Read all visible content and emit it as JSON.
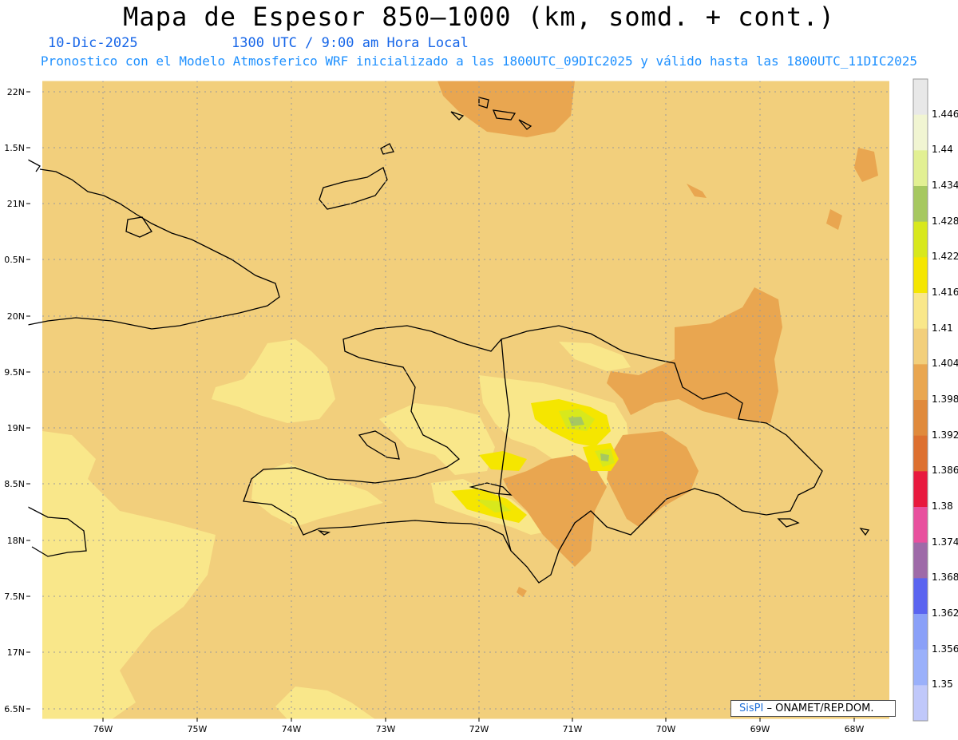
{
  "header": {
    "title": "Mapa de Espesor 850—1000 (km, somd. + cont.)",
    "date": "10-Dic-2025",
    "time": "1300 UTC / 9:00 am Hora Local",
    "description": "Pronostico con el Modelo Atmosferico WRF inicializado a las 1800UTC_09DIC2025 y válido hasta las  1800UTC_11DIC2025"
  },
  "axes": {
    "lat_labels": [
      "22N",
      "1.5N",
      "21N",
      "0.5N",
      "20N",
      "9.5N",
      "19N",
      "8.5N",
      "18N",
      "7.5N",
      "17N",
      "6.5N"
    ],
    "lon_labels": [
      "76W",
      "75W",
      "74W",
      "73W",
      "72W",
      "71W",
      "70W",
      "69W",
      "68W"
    ]
  },
  "colorbar": {
    "labels": [
      "1.446",
      "1.44",
      "1.434",
      "1.428",
      "1.422",
      "1.416",
      "1.41",
      "1.404",
      "1.398",
      "1.392",
      "1.386",
      "1.38",
      "1.374",
      "1.368",
      "1.362",
      "1.356",
      "1.35"
    ],
    "colors": [
      "#e8e8e8",
      "#f1f5d2",
      "#e2f093",
      "#a6c860",
      "#d8e81c",
      "#f5e600",
      "#f9e78a",
      "#f2cf7c",
      "#e9a650",
      "#e08a3c",
      "#dd7030",
      "#e8193e",
      "#e8509e",
      "#9e6aa8",
      "#5a64f0",
      "#8aa0f8",
      "#9ab0fa",
      "#c0c8fa"
    ]
  },
  "map_colors": {
    "background": "#f2cf7c",
    "light_yellow": "#f9e78a",
    "orange": "#e9a650",
    "yellow": "#f5e600",
    "yellow_green": "#d8e81c",
    "green": "#a6c860"
  },
  "credit": {
    "brand": "SisPI",
    "text": "– ONAMET/REP.DOM."
  }
}
